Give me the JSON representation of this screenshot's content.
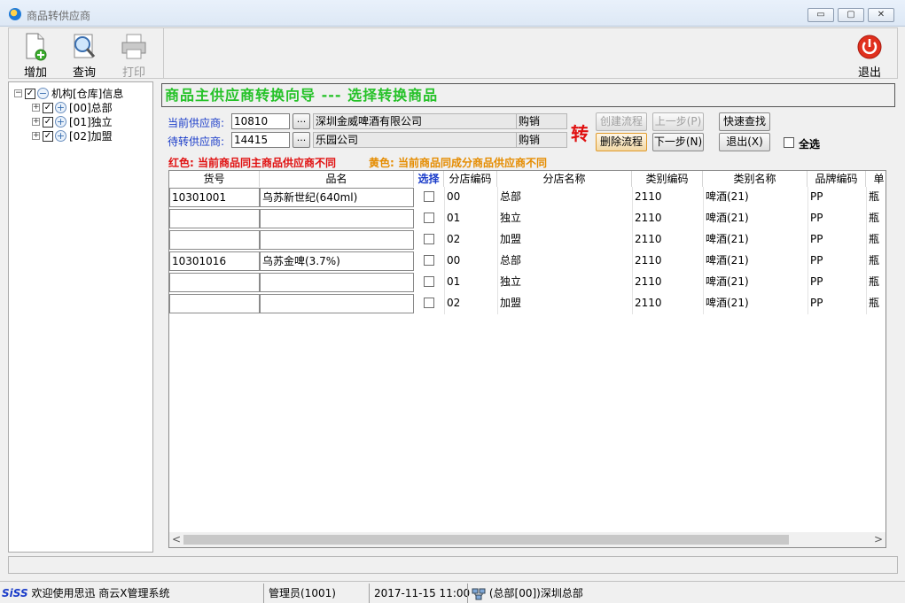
{
  "window": {
    "title": "商品转供应商",
    "minimize": "▭",
    "maximize": "▢",
    "close": "✕"
  },
  "toolbar": {
    "add": "增加",
    "query": "查询",
    "print": "打印",
    "exit": "退出"
  },
  "tree": {
    "root": "机构[仓库]信息",
    "children": [
      "[00]总部",
      "[01]独立",
      "[02]加盟"
    ]
  },
  "wizard": {
    "title": "商品主供应商转换向导 --- 选择转换商品",
    "current_label": "当前供应商:",
    "current_code": "10810",
    "current_name": "深圳金威啤酒有限公司",
    "current_mode": "购销",
    "target_label": "待转供应商:",
    "target_code": "14415",
    "target_name": "乐园公司",
    "target_mode": "购销",
    "dots": "...",
    "zhuan": "转",
    "btn_create": "创建流程",
    "btn_delete": "删除流程",
    "btn_prev": "上一步(P)",
    "btn_next": "下一步(N)",
    "btn_quick": "快速查找",
    "btn_exit": "退出(X)",
    "select_all": "全选",
    "legend_red": "红色: 当前商品同主商品供应商不同",
    "legend_yellow": "黄色: 当前商品同成分商品供应商不同"
  },
  "grid": {
    "columns": [
      "货号",
      "品名",
      "选择",
      "分店编码",
      "分店名称",
      "类别编码",
      "类别名称",
      "品牌编码",
      "单"
    ],
    "rows": [
      {
        "code": "10301001",
        "name": "乌苏新世纪(640ml)",
        "branch_code": "00",
        "branch_name": "总部",
        "cat_code": "2110",
        "cat_name": "啤酒(21)",
        "brand": "PP",
        "unit": "瓶"
      },
      {
        "code": "",
        "name": "",
        "branch_code": "01",
        "branch_name": "独立",
        "cat_code": "2110",
        "cat_name": "啤酒(21)",
        "brand": "PP",
        "unit": "瓶"
      },
      {
        "code": "",
        "name": "",
        "branch_code": "02",
        "branch_name": "加盟",
        "cat_code": "2110",
        "cat_name": "啤酒(21)",
        "brand": "PP",
        "unit": "瓶"
      },
      {
        "code": "10301016",
        "name": "乌苏金啤(3.7%)",
        "branch_code": "00",
        "branch_name": "总部",
        "cat_code": "2110",
        "cat_name": "啤酒(21)",
        "brand": "PP",
        "unit": "瓶"
      },
      {
        "code": "",
        "name": "",
        "branch_code": "01",
        "branch_name": "独立",
        "cat_code": "2110",
        "cat_name": "啤酒(21)",
        "brand": "PP",
        "unit": "瓶"
      },
      {
        "code": "",
        "name": "",
        "branch_code": "02",
        "branch_name": "加盟",
        "cat_code": "2110",
        "cat_name": "啤酒(21)",
        "brand": "PP",
        "unit": "瓶"
      }
    ],
    "scroll_left": "<",
    "scroll_right": ">"
  },
  "status": {
    "logo": "SiSS",
    "welcome": "欢迎使用思迅 商云X管理系统",
    "user": "管理员(1001)",
    "datetime": "2017-11-15 11:00",
    "branch": "(总部[00])深圳总部"
  },
  "colors": {
    "wizard_title": "#25c228",
    "label_blue": "#1a3cc9",
    "red": "#e01010",
    "yellow": "#e58c00"
  }
}
